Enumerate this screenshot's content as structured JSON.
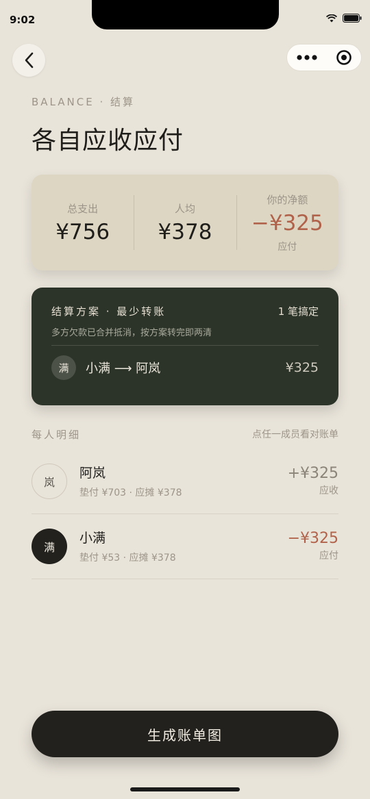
{
  "status": {
    "time": "9:02"
  },
  "header": {
    "eyebrow": "BALANCE · 结算",
    "title": "各自应收应付"
  },
  "summary": {
    "total_label": "总支出",
    "total_value": "¥756",
    "avg_label": "人均",
    "avg_value": "¥378",
    "net_label": "你的净额",
    "net_value": "−¥325",
    "net_status": "应付",
    "net_color": "#b0634a"
  },
  "settlement": {
    "title": "结算方案 · 最少转账",
    "count": "1 笔搞定",
    "note": "多方欠款已合并抵消，按方案转完即两清",
    "transfer": {
      "avatar": "满",
      "text": "小满 ⟶ 阿岚",
      "amount": "¥325"
    }
  },
  "members": {
    "title": "每人明细",
    "hint": "点任一成员看对账单",
    "items": [
      {
        "avatar": "岚",
        "name": "阿岚",
        "detail": "垫付 ¥703 · 应摊 ¥378",
        "amount": "+¥325",
        "status": "应收"
      },
      {
        "avatar": "满",
        "name": "小满",
        "detail": "垫付 ¥53 · 应摊 ¥378",
        "amount": "−¥325",
        "status": "应付"
      }
    ]
  },
  "cta": {
    "label": "生成账单图"
  },
  "colors": {
    "background": "#e9e4da",
    "accent_negative": "#b0634a",
    "card_dark": "#2c3328",
    "card_light": "#ddd6c3"
  }
}
